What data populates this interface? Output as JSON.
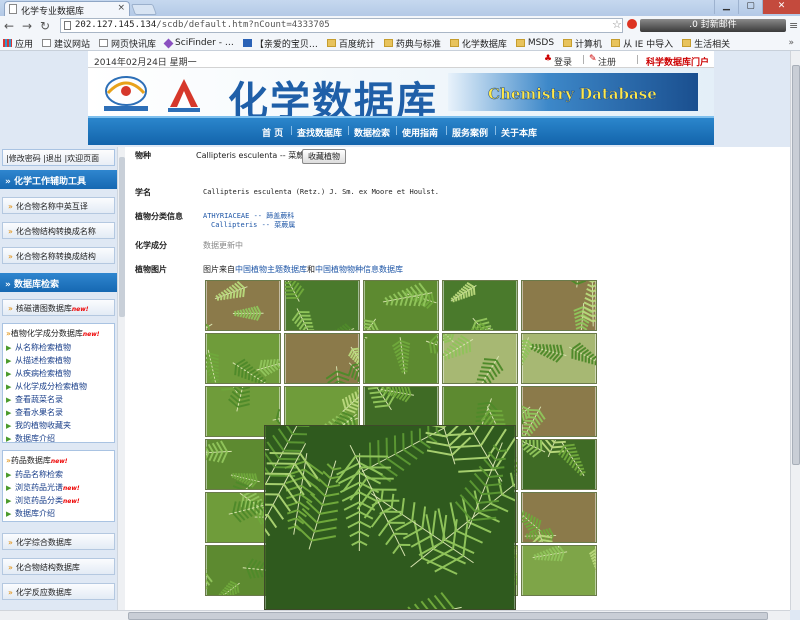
{
  "browser": {
    "tab_title": "化学专业数据库",
    "tab_close": "×",
    "nav_icons": [
      "back-arrow",
      "forward-arrow",
      "reload"
    ],
    "url_host": "202.127.145.134",
    "url_path": "/scdb/default.htm?nCount=4333705",
    "notification": ".0 封新邮件",
    "window_buttons": [
      "▁",
      "▢",
      "✕"
    ],
    "bookmarks": [
      {
        "label": "应用",
        "icon": "apps-grid-icon"
      },
      {
        "label": "建议网站",
        "icon": "page-icon"
      },
      {
        "label": "网页快讯库",
        "icon": "page-icon"
      },
      {
        "label": "SciFinder - …",
        "icon": "scifinder-icon"
      },
      {
        "label": "【亲爱的宝贝…",
        "icon": "blue-page-icon"
      },
      {
        "label": "百度统计",
        "icon": "folder-icon"
      },
      {
        "label": "药典与标准",
        "icon": "folder-icon"
      },
      {
        "label": "化学数据库",
        "icon": "folder-icon"
      },
      {
        "label": "MSDS",
        "icon": "folder-icon"
      },
      {
        "label": "计算机",
        "icon": "folder-icon"
      },
      {
        "label": "从 IE 中导入",
        "icon": "folder-icon"
      },
      {
        "label": "生活相关",
        "icon": "folder-icon"
      }
    ],
    "bookmarks_more": "»"
  },
  "site": {
    "date": "2014年02月24日  星期一",
    "login": "登录",
    "register": "注册",
    "portal": "科学数据库门户",
    "title": "化学数据库",
    "english_title": "Chemistry Database",
    "nav": [
      "首 页",
      "查找数据库",
      "数据检索",
      "使用指南",
      "服务案例",
      "关于本库"
    ]
  },
  "sidebar": {
    "top_links": "|修改密码  |退出  |欢迎页面",
    "tools_header": "化学工作辅助工具",
    "tools": [
      "化合物名称中英互译",
      "化合物结构转换成名称",
      "化合物名称转换成结构"
    ],
    "search_header": "数据库检索",
    "spectra_db": "核磁谱图数据库",
    "plant_db": "植物化学成分数据库",
    "plant_items": [
      "从名称检索植物",
      "从描述检索植物",
      "从疾病检索植物",
      "从化学成分检索植物",
      "查看蔬菜名录",
      "查看水果名录",
      "我的植物收藏夹",
      "数据库介绍"
    ],
    "drug_db": "药品数据库",
    "drug_items": [
      "药品名称检索",
      "浏览药品光谱",
      "浏览药品分类",
      "数据库介绍"
    ],
    "drug_new_flags": [
      false,
      true,
      true,
      false
    ],
    "bottom_dbs": [
      "化学综合数据库",
      "化合物结构数据库",
      "化学反应数据库"
    ],
    "new_tag": "new!"
  },
  "record": {
    "species_label": "物种",
    "species_value": "Callipteris esculenta -- 菜蕨",
    "collect_button": "收藏植物",
    "sciname_label": "学名",
    "sciname_value": "Callipteris esculenta (Retz.) J. Sm. ex Moore et Houlst.",
    "taxonomy_label": "植物分类信息",
    "taxonomy_family": "ATHYRIACEAE -- 蹄盖蕨科",
    "taxonomy_genus": "Callipteris -- 菜蕨属",
    "chem_label": "化学成分",
    "chem_value": "数据更新中",
    "photo_label": "植物图片",
    "photo_prefix": "图片来自",
    "photo_source1": "中国植物主题数据库",
    "photo_and": "和",
    "photo_source2": "中国植物物种信息数据库"
  },
  "gallery": {
    "columns": 5,
    "rows": 6,
    "palette": [
      "#3f6b25",
      "#5d8a30",
      "#7ea548",
      "#2e4f1c",
      "#8b7a4a",
      "#6f9c3a",
      "#4a7a2c",
      "#a7b873",
      "#385a22",
      "#9a6a34"
    ]
  }
}
